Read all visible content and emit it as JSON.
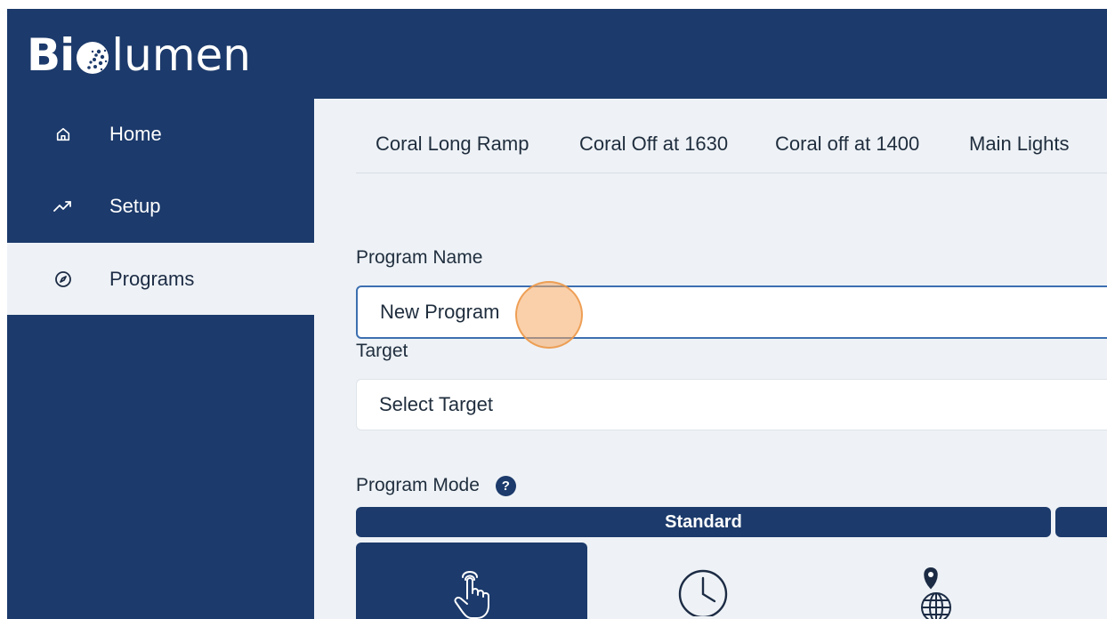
{
  "brand": {
    "name_left": "Bi",
    "name_right": "lumen",
    "colors": {
      "primary": "#1c3a6b",
      "background": "#eef2f6",
      "highlight": "#f5aa64"
    }
  },
  "sidebar": {
    "items": [
      {
        "label": "Home",
        "icon": "home-icon",
        "active": false
      },
      {
        "label": "Setup",
        "icon": "trending-up-icon",
        "active": false
      },
      {
        "label": "Programs",
        "icon": "compass-icon",
        "active": true
      }
    ]
  },
  "tabs": [
    {
      "label": "Coral Long Ramp"
    },
    {
      "label": "Coral Off at 1630"
    },
    {
      "label": "Coral off at 1400"
    },
    {
      "label": "Main Lights"
    }
  ],
  "form": {
    "program_name_label": "Program Name",
    "program_name_value": "New Program",
    "target_label": "Target",
    "target_value": "Select Target",
    "program_mode_label": "Program Mode",
    "help_glyph": "?",
    "mode_bar_label": "Standard",
    "modes": [
      {
        "icon": "touch-hand-icon",
        "selected": true
      },
      {
        "icon": "clock-icon",
        "selected": false
      },
      {
        "icon": "globe-pin-icon",
        "selected": false
      }
    ]
  }
}
